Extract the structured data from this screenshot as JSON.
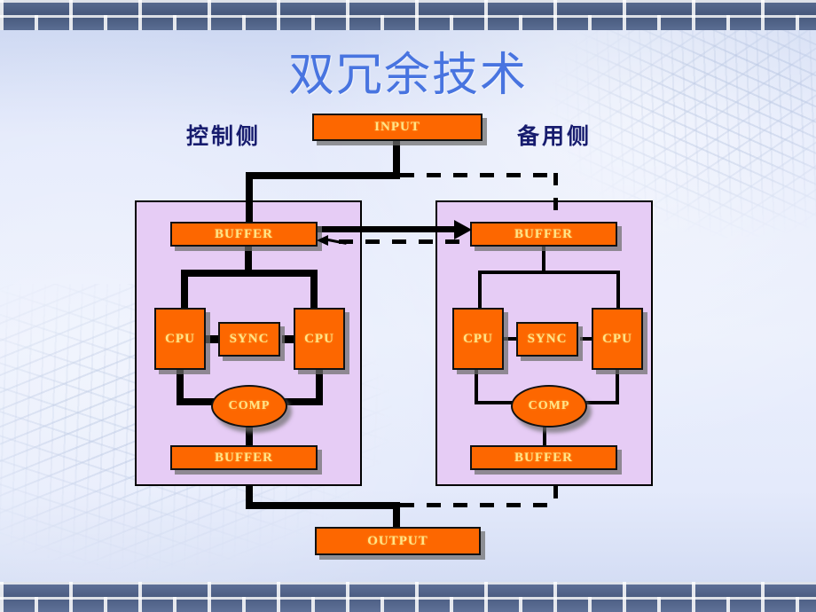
{
  "slide": {
    "title": "双冗余技术",
    "side_labels": {
      "left": "控制侧",
      "right": "备用侧"
    },
    "colors": {
      "title": "#4874e0",
      "side_label": "#171c6e",
      "node_fill": "#fd6700",
      "node_text": "#ffe489",
      "panel_fill": "#e6ccf5",
      "connector": "#000000",
      "brick": "#4b5d82",
      "background": "#e3e9fb"
    },
    "nodes": {
      "input": "INPUT",
      "output": "OUTPUT"
    },
    "channels": [
      {
        "id": "control-side",
        "label": "控制侧",
        "buffer_in": "BUFFER",
        "cpu_a": "CPU",
        "sync": "SYNC",
        "cpu_b": "CPU",
        "comp": "COMP",
        "buffer_out": "BUFFER"
      },
      {
        "id": "standby-side",
        "label": "备用侧",
        "buffer_in": "BUFFER",
        "cpu_a": "CPU",
        "sync": "SYNC",
        "cpu_b": "CPU",
        "comp": "COMP",
        "buffer_out": "BUFFER"
      }
    ]
  }
}
